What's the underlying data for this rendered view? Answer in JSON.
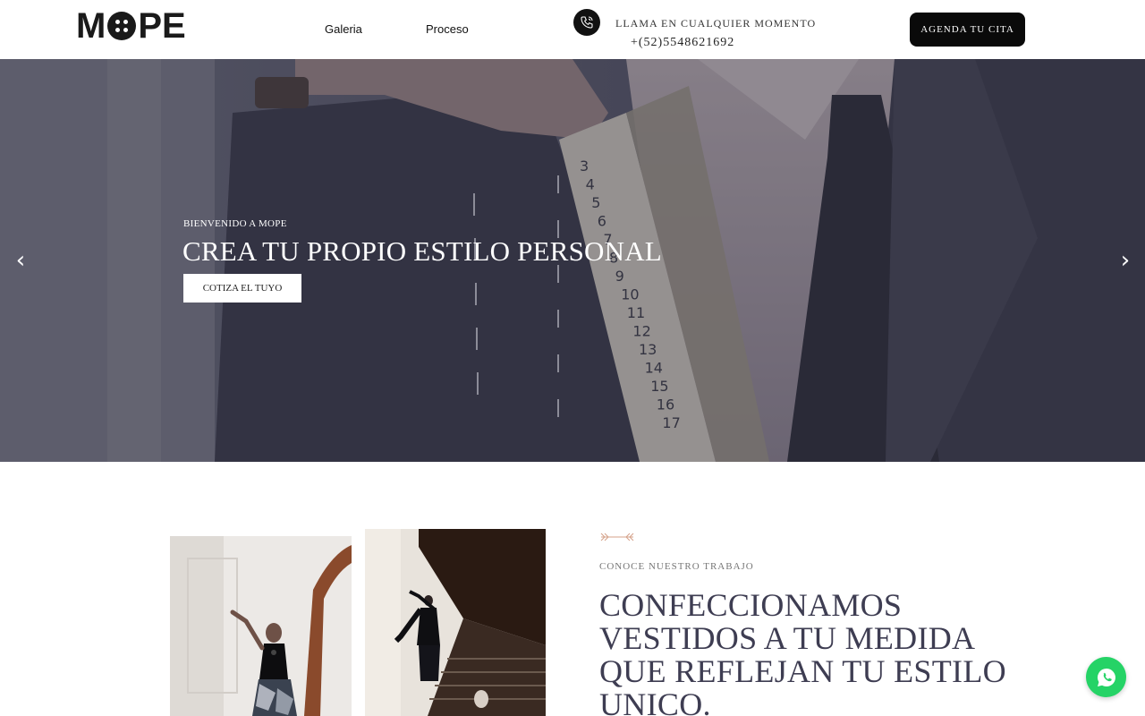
{
  "header": {
    "logo_text": "MOPE",
    "nav": [
      {
        "label": "Galeria"
      },
      {
        "label": "Proceso"
      }
    ],
    "call_label": "LLAMA EN CUALQUIER MOMENTO",
    "phone": "+(52)5548621692",
    "cta_label": "AGENDA TU CITA"
  },
  "hero": {
    "eyebrow": "BIENVENIDO A MOPE",
    "title": "CREA TU PROPIO ESTILO PERSONAL",
    "button_label": "COTIZA EL TUYO",
    "tape_numbers": [
      "3",
      "4",
      "5",
      "6",
      "7",
      "8",
      "9",
      "10",
      "11",
      "12",
      "13",
      "14",
      "15",
      "16",
      "17"
    ]
  },
  "about": {
    "eyebrow": "CONOCE NUESTRO TRABAJO",
    "title": "CONFECCIONAMOS VESTIDOS A TU MEDIDA QUE REFLEJAN TU ESTILO UNICO."
  },
  "colors": {
    "accent": "#d4a28a",
    "heading": "#3e3d52",
    "whatsapp": "#25d366",
    "cta_bg": "#0a0a0a"
  }
}
